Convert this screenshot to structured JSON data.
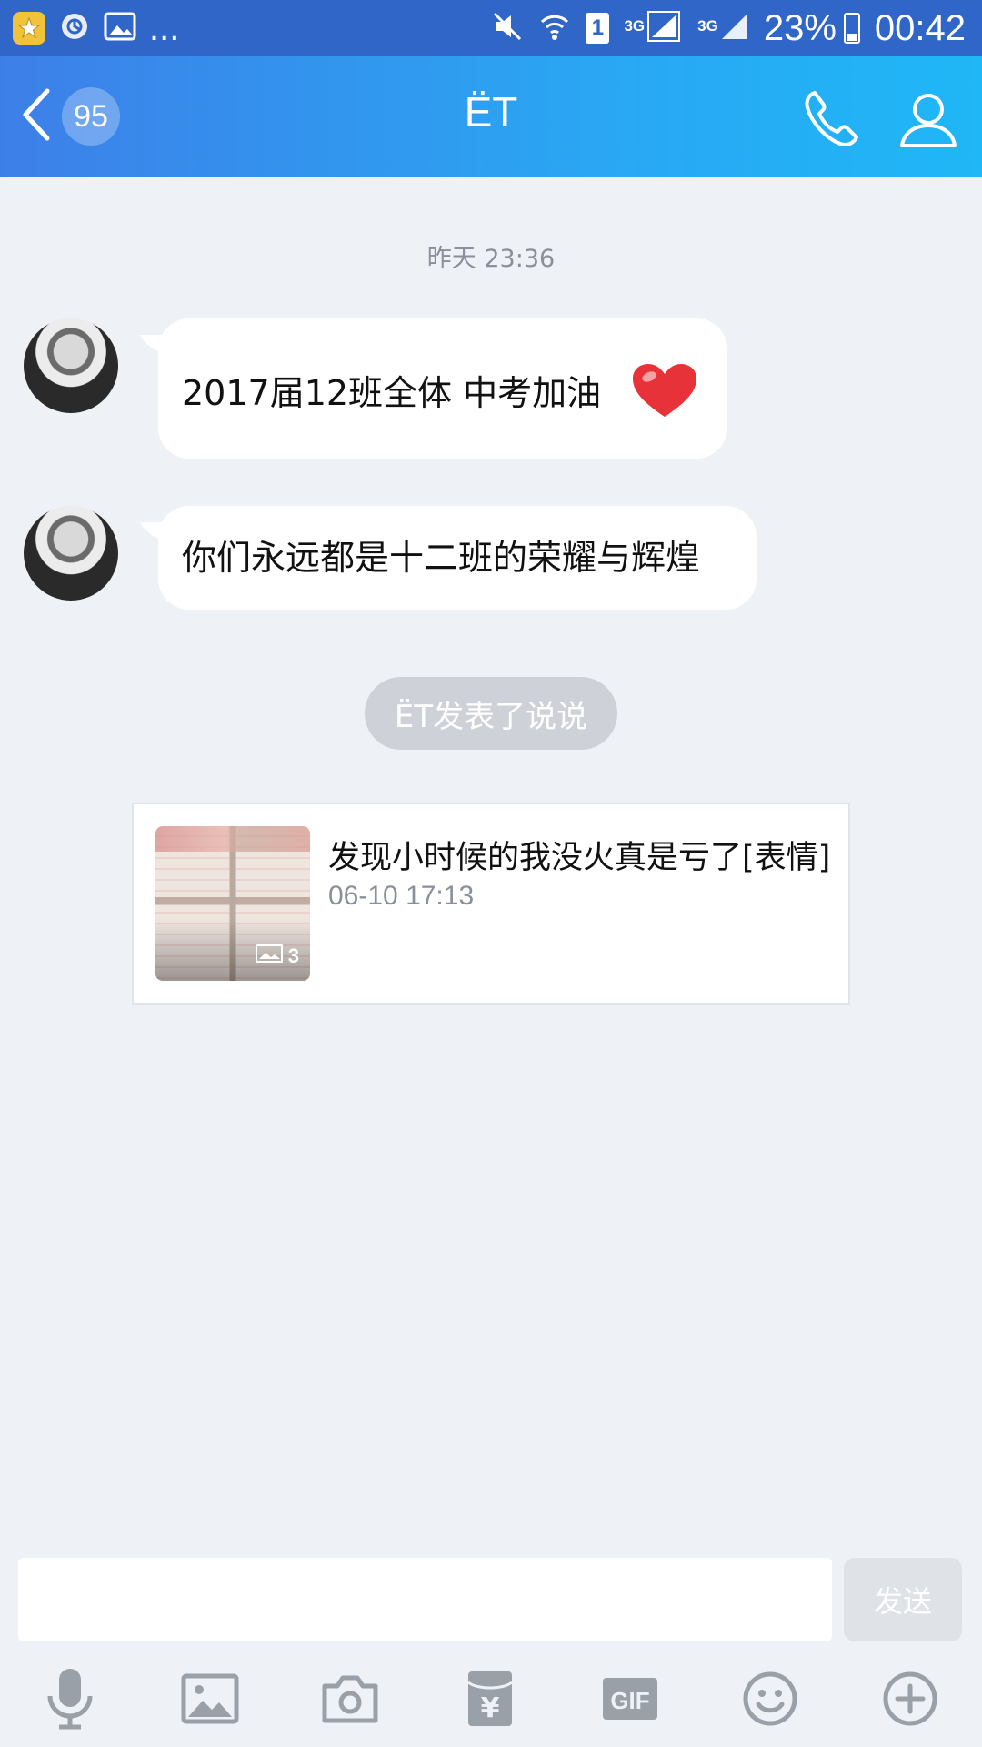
{
  "status_bar": {
    "dots": "...",
    "network_1": "3G",
    "network_2": "3G",
    "sim": "1",
    "battery": "23%",
    "time": "00:42"
  },
  "header": {
    "unread_count": "95",
    "title": "ЁT"
  },
  "chat": {
    "timestamp": "昨天 23:36",
    "messages": [
      {
        "text": "2017届12班全体  中考加油"
      },
      {
        "text": "你们永远都是十二班的荣耀与辉煌"
      }
    ],
    "system_notice": "ЁT发表了说说",
    "share_card": {
      "title": "发现小时候的我没火真是亏了[表情]",
      "time": "06-10 17:13",
      "photo_count": "3"
    }
  },
  "input_bar": {
    "placeholder": "",
    "send_label": "发送"
  },
  "toolbar": {
    "items": [
      "mic-icon",
      "image-icon",
      "camera-icon",
      "red-packet-icon",
      "gif-icon",
      "emoji-icon",
      "plus-icon"
    ],
    "gif_label": "GIF",
    "red_packet_label": "¥"
  },
  "colors": {
    "header_gradient_start": "#3d7fe8",
    "header_gradient_end": "#1fb7f6",
    "status_bar": "#2f66c8",
    "background": "#eef1f6",
    "toolbar_icon": "#9aa0a8"
  }
}
